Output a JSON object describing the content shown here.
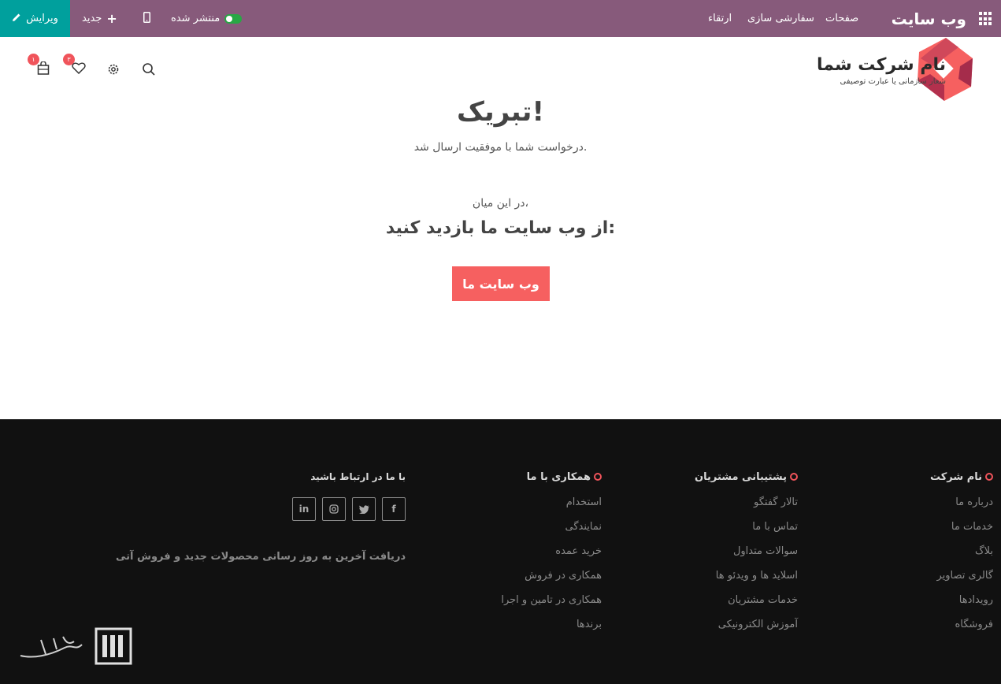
{
  "topbar": {
    "edit_label": "ویرایش",
    "new_label": "جدید",
    "published_label": "منتشر شده",
    "menu": [
      "صفحات",
      "سفارشی سازی",
      "ارتقاء"
    ],
    "brand": "وب سایت",
    "bg_color": "#875a7b",
    "edit_color": "#00a09d"
  },
  "header": {
    "logo_name": "نام شرکت شما",
    "logo_tagline": "شعار سازمانی یا عبارت توصیفی",
    "wishlist_count": "۳",
    "cart_count": "۱",
    "icons": [
      "search-icon",
      "gear-icon",
      "heart-icon",
      "cart-icon"
    ]
  },
  "main": {
    "title": "تبریک!",
    "subtitle": "درخواست شما با موفقیت ارسال شد.",
    "meanwhile": "در این میان،",
    "visit": "از وب سایت ما بازدید کنید:",
    "button": "وب سایت ما",
    "accent": "#f66060"
  },
  "footer": {
    "col1": {
      "title": "نام شرکت",
      "links": [
        "درباره ما",
        "خدمات ما",
        "بلاگ",
        "گالری تصاویر",
        "رویدادها",
        "فروشگاه"
      ]
    },
    "col2": {
      "title": "پشتیبانی مشتریان",
      "links": [
        "تالار گفتگو",
        "تماس با ما",
        "سوالات متداول",
        "اسلاید ها و ویدئو ها",
        "خدمات مشتریان",
        "آموزش الکترونیکی"
      ]
    },
    "col3": {
      "title": "همکاری با ما",
      "links": [
        "استخدام",
        "نمایندگی",
        "خرید عمده",
        "همکاری در فروش",
        "همکاری در تامین و اجرا",
        "برندها"
      ]
    },
    "col4": {
      "title": "با ما در ارتباط باشید",
      "newsletter": "دریافت آخرین به روز رسانی محصولات جدید و فروش آتی"
    },
    "social": [
      "facebook-icon",
      "twitter-icon",
      "instagram-icon",
      "linkedin-icon"
    ],
    "bg_color": "#111111"
  }
}
